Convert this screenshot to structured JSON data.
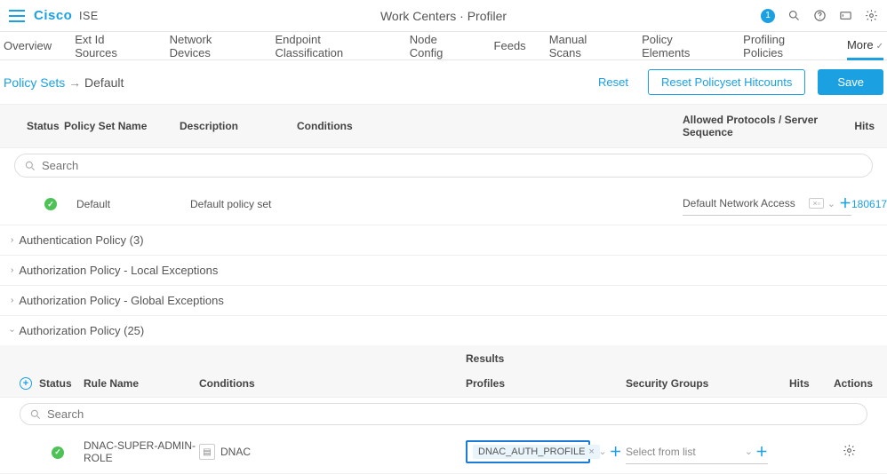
{
  "header": {
    "brand": "Cisco",
    "product": "ISE",
    "title": "Work Centers · Profiler",
    "badge": "1"
  },
  "tabs": [
    "Overview",
    "Ext Id Sources",
    "Network Devices",
    "Endpoint Classification",
    "Node Config",
    "Feeds",
    "Manual Scans",
    "Policy Elements",
    "Profiling Policies",
    "More"
  ],
  "breadcrumb": {
    "root": "Policy Sets",
    "current": "Default"
  },
  "actions": {
    "reset": "Reset",
    "reset_hit": "Reset Policyset Hitcounts",
    "save": "Save"
  },
  "grid": {
    "cols": {
      "status": "Status",
      "name": "Policy Set Name",
      "desc": "Description",
      "cond": "Conditions",
      "allowed": "Allowed Protocols / Server Sequence",
      "hits": "Hits"
    },
    "search_placeholder": "Search",
    "row": {
      "name": "Default",
      "desc": "Default policy set",
      "allowed": "Default Network Access",
      "hits": "180617"
    }
  },
  "sections": {
    "auth_policy": "Authentication Policy (3)",
    "authz_local": "Authorization Policy - Local Exceptions",
    "authz_global": "Authorization Policy - Global Exceptions",
    "authz_policy": "Authorization Policy (25)"
  },
  "sub": {
    "cols": {
      "status": "Status",
      "rule": "Rule Name",
      "cond": "Conditions",
      "results": "Results",
      "profiles": "Profiles",
      "sec": "Security Groups",
      "hits": "Hits",
      "actions": "Actions"
    },
    "search_placeholder": "Search",
    "row": {
      "name": "DNAC-SUPER-ADMIN-ROLE",
      "cond": "DNAC",
      "profile": "DNAC_AUTH_PROFILE",
      "sec": "Select from list"
    }
  }
}
